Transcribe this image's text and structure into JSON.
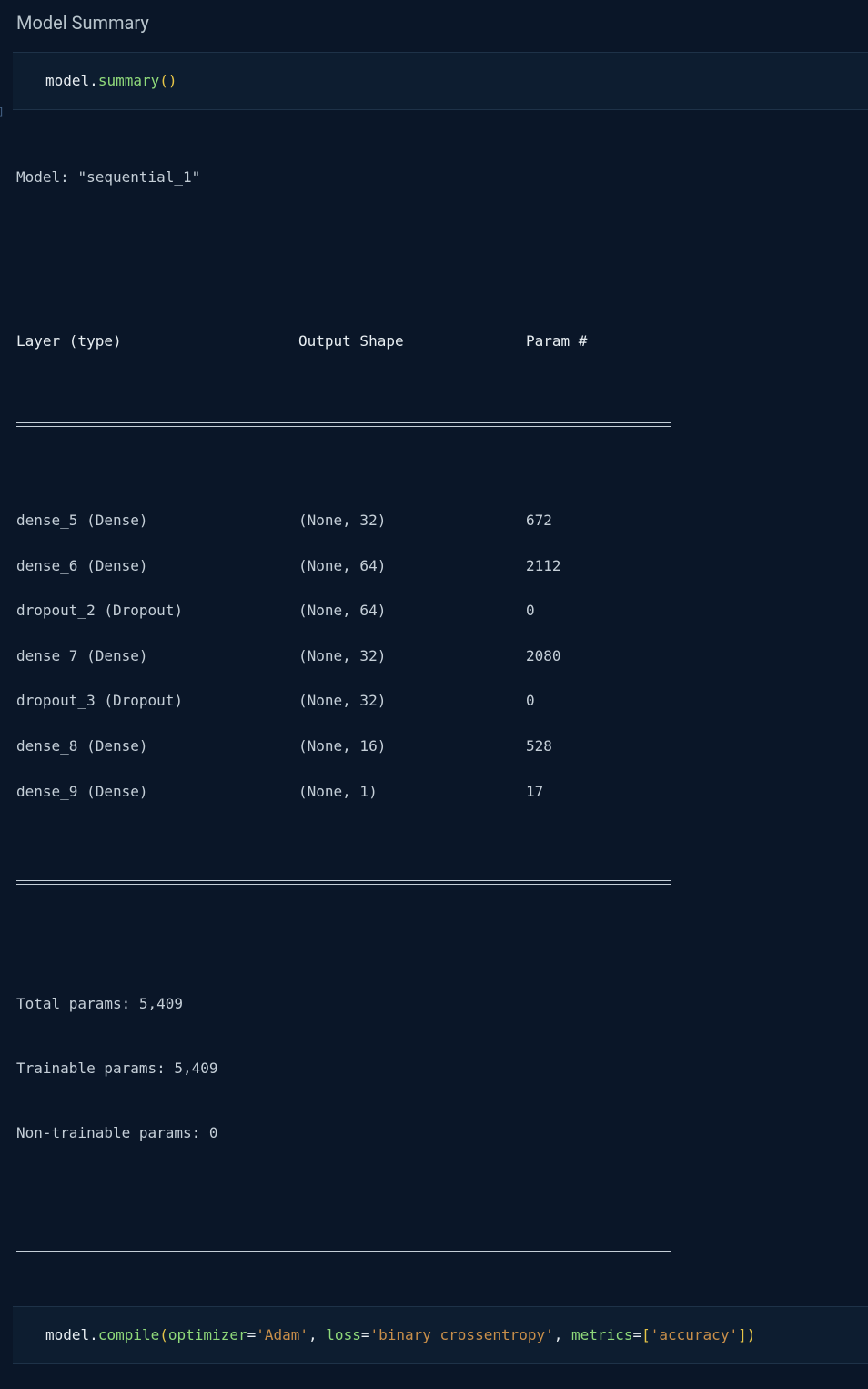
{
  "section_title": "Model Summary",
  "code1": {
    "t0": "model",
    "t1": ".",
    "t2": "summary",
    "t3": "()"
  },
  "output": {
    "model_label": "Model: ",
    "model_name": "\"sequential_1\"",
    "headers": {
      "layer": "Layer (type)",
      "shape": "Output Shape",
      "param": "Param #"
    },
    "rows": [
      {
        "layer": "dense_5 (Dense)",
        "shape": "(None, 32)",
        "param": "672"
      },
      {
        "layer": "dense_6 (Dense)",
        "shape": "(None, 64)",
        "param": "2112"
      },
      {
        "layer": "dropout_2 (Dropout)",
        "shape": "(None, 64)",
        "param": "0"
      },
      {
        "layer": "dense_7 (Dense)",
        "shape": "(None, 32)",
        "param": "2080"
      },
      {
        "layer": "dropout_3 (Dropout)",
        "shape": "(None, 32)",
        "param": "0"
      },
      {
        "layer": "dense_8 (Dense)",
        "shape": "(None, 16)",
        "param": "528"
      },
      {
        "layer": "dense_9 (Dense)",
        "shape": "(None, 1)",
        "param": "17"
      }
    ],
    "footer": {
      "total": "Total params: 5,409",
      "trainable": "Trainable params: 5,409",
      "non_trainable": "Non-trainable params: 0"
    }
  },
  "code2": {
    "t0": "model",
    "t1": ".",
    "t2": "compile",
    "t3": "(",
    "t4": "optimizer",
    "t5": "=",
    "t6": "'Adam'",
    "t7": ", ",
    "t8": "loss",
    "t9": "=",
    "t10": "'binary_crossentropy'",
    "t11": ", ",
    "t12": "metrics",
    "t13": "=",
    "t14": "[",
    "t15": "'accuracy'",
    "t16": "]",
    "t17": ")"
  },
  "left_marker": "]"
}
